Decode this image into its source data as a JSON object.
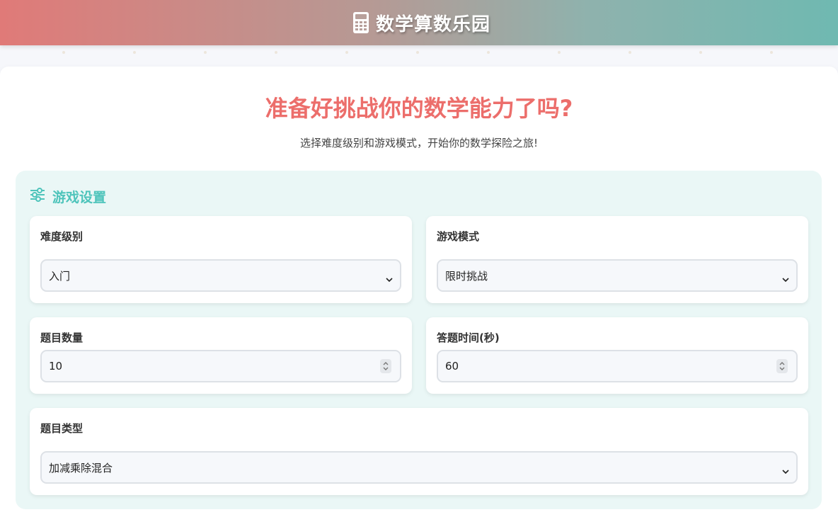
{
  "header": {
    "title": "数学算数乐园",
    "icon": "calculator-icon"
  },
  "hero": {
    "title": "准备好挑战你的数学能力了吗?",
    "subtitle": "选择难度级别和游戏模式，开始你的数学探险之旅!"
  },
  "settings": {
    "title": "游戏设置",
    "icon": "sliders-icon",
    "difficulty": {
      "label": "难度级别",
      "value": "入门"
    },
    "mode": {
      "label": "游戏模式",
      "value": "限时挑战"
    },
    "question_count": {
      "label": "题目数量",
      "value": "10"
    },
    "answer_time": {
      "label": "答题时间(秒)",
      "value": "60"
    },
    "question_type": {
      "label": "题目类型",
      "value": "加减乘除混合"
    }
  },
  "colors": {
    "accent_red": "#ec6e6b",
    "accent_teal": "#4ec4bb",
    "panel_bg": "#eaf7f6"
  }
}
